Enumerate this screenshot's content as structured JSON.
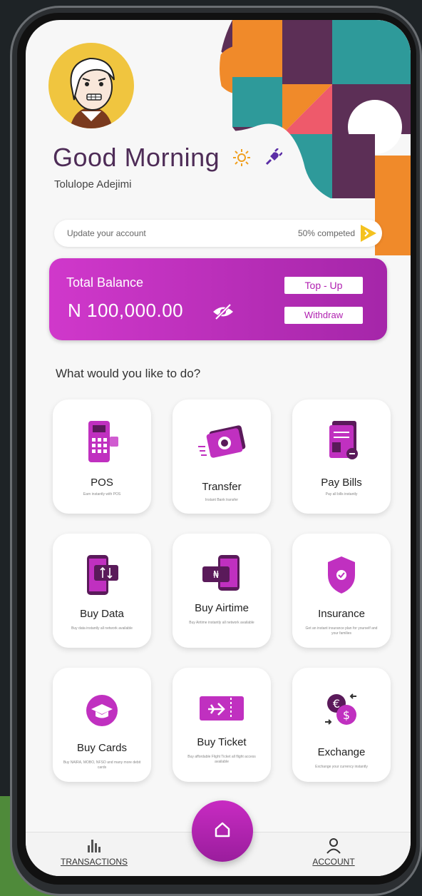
{
  "greeting": {
    "title": "Good Morning",
    "user_name": "Tolulope Adejimi"
  },
  "update_bar": {
    "label": "Update your account",
    "progress_text": "50% competed",
    "progress": 0.5
  },
  "balance": {
    "label": "Total Balance",
    "amount": "N 100,000.00",
    "top_up_label": "Top - Up",
    "withdraw_label": "Withdraw"
  },
  "question": "What would you like to do?",
  "services": [
    {
      "title": "POS",
      "subtitle": "Earn instantly with POS",
      "icon": "pos-terminal-icon"
    },
    {
      "title": "Transfer",
      "subtitle": "Instant Bank transfer",
      "icon": "money-transfer-icon"
    },
    {
      "title": "Pay Bills",
      "subtitle": "Pay all bills instantly",
      "icon": "bill-invoice-icon"
    },
    {
      "title": "Buy Data",
      "subtitle": "Buy data instantly all network available",
      "icon": "mobile-data-icon"
    },
    {
      "title": "Buy Airtime",
      "subtitle": "Buy Airtime instantly all network available",
      "icon": "mobile-airtime-icon"
    },
    {
      "title": "Insurance",
      "subtitle": "Get an instant insurance plan for yourself and your families",
      "icon": "shield-check-icon"
    },
    {
      "title": "Buy Cards",
      "subtitle": "Buy NAIRA, MOBO, NFSO and many more debit cards",
      "icon": "graduation-cap-icon"
    },
    {
      "title": "Buy Ticket",
      "subtitle": "Buy affordable Flight Ticket all flight access available",
      "icon": "flight-ticket-icon"
    },
    {
      "title": "Exchange",
      "subtitle": "Exchange your currency instantly",
      "icon": "currency-exchange-icon"
    }
  ],
  "nav": {
    "transactions_label": "TRANSACTIONS",
    "account_label": "ACCOUNT"
  },
  "colors": {
    "brand": "#c030c0",
    "greeting": "#4e2c57",
    "accent_yellow": "#f4c21f"
  }
}
